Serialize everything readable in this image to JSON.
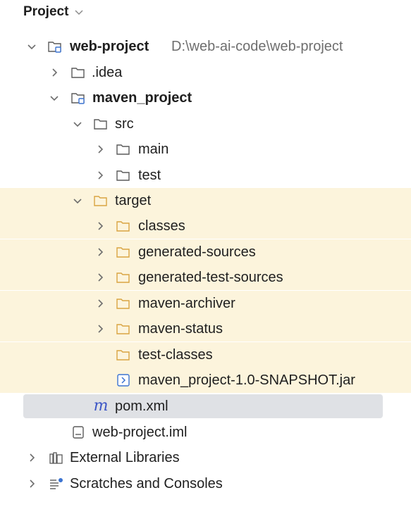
{
  "header": {
    "title": "Project"
  },
  "tree": {
    "root_label": "web-project",
    "root_path": "D:\\web-ai-code\\web-project",
    "idea": ".idea",
    "module": "maven_project",
    "src": "src",
    "main": "main",
    "test": "test",
    "target": "target",
    "classes": "classes",
    "generated_sources": "generated-sources",
    "generated_test_sources": "generated-test-sources",
    "maven_archiver": "maven-archiver",
    "maven_status": "maven-status",
    "test_classes": "test-classes",
    "jar": "maven_project-1.0-SNAPSHOT.jar",
    "pom": "pom.xml",
    "pom_icon": "m",
    "iml": "web-project.iml",
    "external_libraries": "External Libraries",
    "scratches": "Scratches and Consoles"
  },
  "icons": {
    "folder": "folder-icon",
    "module": "module-folder-icon",
    "jar": "archive-icon",
    "iml": "file-icon",
    "libraries": "libraries-icon",
    "scratches": "scratches-icon"
  },
  "colors": {
    "excluded_background": "#fcf4dc",
    "excluded_folder": "#d9a441",
    "selected_row": "#dfe1e5",
    "module_accent": "#3b73d1",
    "maven_m": "#3b55c6",
    "path_text": "#6e6e6e"
  }
}
